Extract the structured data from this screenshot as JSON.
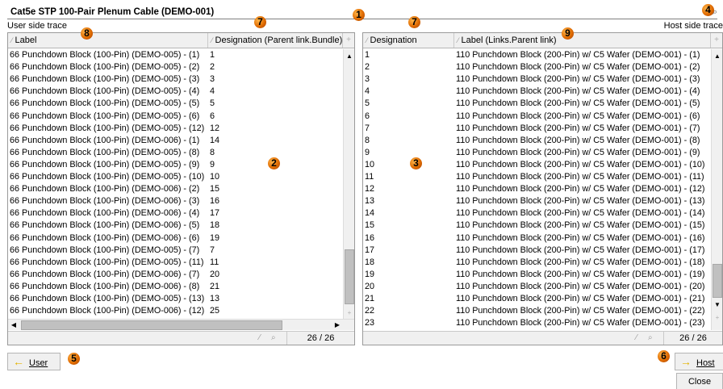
{
  "window": {
    "title": "Cat5e STP 100-Pair Plenum Cable (DEMO-001)"
  },
  "user_side": {
    "label": "User side trace"
  },
  "host_side": {
    "label": "Host side trace"
  },
  "left_table": {
    "columns": [
      "Label",
      "Designation (Parent link.Bundle)"
    ],
    "rows": [
      [
        "66 Punchdown Block (100-Pin) (DEMO-005) - (1)",
        "1"
      ],
      [
        "66 Punchdown Block (100-Pin) (DEMO-005) - (2)",
        "2"
      ],
      [
        "66 Punchdown Block (100-Pin) (DEMO-005) - (3)",
        "3"
      ],
      [
        "66 Punchdown Block (100-Pin) (DEMO-005) - (4)",
        "4"
      ],
      [
        "66 Punchdown Block (100-Pin) (DEMO-005) - (5)",
        "5"
      ],
      [
        "66 Punchdown Block (100-Pin) (DEMO-005) - (6)",
        "6"
      ],
      [
        "66 Punchdown Block (100-Pin) (DEMO-005) - (12)",
        "12"
      ],
      [
        "66 Punchdown Block (100-Pin) (DEMO-006) - (1)",
        "14"
      ],
      [
        "66 Punchdown Block (100-Pin) (DEMO-005) - (8)",
        "8"
      ],
      [
        "66 Punchdown Block (100-Pin) (DEMO-005) - (9)",
        "9"
      ],
      [
        "66 Punchdown Block (100-Pin) (DEMO-005) - (10)",
        "10"
      ],
      [
        "66 Punchdown Block (100-Pin) (DEMO-006) - (2)",
        "15"
      ],
      [
        "66 Punchdown Block (100-Pin) (DEMO-006) - (3)",
        "16"
      ],
      [
        "66 Punchdown Block (100-Pin) (DEMO-006) - (4)",
        "17"
      ],
      [
        "66 Punchdown Block (100-Pin) (DEMO-006) - (5)",
        "18"
      ],
      [
        "66 Punchdown Block (100-Pin) (DEMO-006) - (6)",
        "19"
      ],
      [
        "66 Punchdown Block (100-Pin) (DEMO-005) - (7)",
        "7"
      ],
      [
        "66 Punchdown Block (100-Pin) (DEMO-005) - (11)",
        "11"
      ],
      [
        "66 Punchdown Block (100-Pin) (DEMO-006) - (7)",
        "20"
      ],
      [
        "66 Punchdown Block (100-Pin) (DEMO-006) - (8)",
        "21"
      ],
      [
        "66 Punchdown Block (100-Pin) (DEMO-005) - (13)",
        "13"
      ],
      [
        "66 Punchdown Block (100-Pin) (DEMO-006) - (12)",
        "25"
      ]
    ],
    "counter": "26 / 26"
  },
  "right_table": {
    "columns": [
      "Designation",
      "Label (Links.Parent link)"
    ],
    "rows": [
      [
        "1",
        "110 Punchdown Block (200-Pin) w/ C5 Wafer (DEMO-001) - (1)"
      ],
      [
        "2",
        "110 Punchdown Block (200-Pin) w/ C5 Wafer (DEMO-001) - (2)"
      ],
      [
        "3",
        "110 Punchdown Block (200-Pin) w/ C5 Wafer (DEMO-001) - (3)"
      ],
      [
        "4",
        "110 Punchdown Block (200-Pin) w/ C5 Wafer (DEMO-001) - (4)"
      ],
      [
        "5",
        "110 Punchdown Block (200-Pin) w/ C5 Wafer (DEMO-001) - (5)"
      ],
      [
        "6",
        "110 Punchdown Block (200-Pin) w/ C5 Wafer (DEMO-001) - (6)"
      ],
      [
        "7",
        "110 Punchdown Block (200-Pin) w/ C5 Wafer (DEMO-001) - (7)"
      ],
      [
        "8",
        "110 Punchdown Block (200-Pin) w/ C5 Wafer (DEMO-001) - (8)"
      ],
      [
        "9",
        "110 Punchdown Block (200-Pin) w/ C5 Wafer (DEMO-001) - (9)"
      ],
      [
        "10",
        "110 Punchdown Block (200-Pin) w/ C5 Wafer (DEMO-001) - (10)"
      ],
      [
        "11",
        "110 Punchdown Block (200-Pin) w/ C5 Wafer (DEMO-001) - (11)"
      ],
      [
        "12",
        "110 Punchdown Block (200-Pin) w/ C5 Wafer (DEMO-001) - (12)"
      ],
      [
        "13",
        "110 Punchdown Block (200-Pin) w/ C5 Wafer (DEMO-001) - (13)"
      ],
      [
        "14",
        "110 Punchdown Block (200-Pin) w/ C5 Wafer (DEMO-001) - (14)"
      ],
      [
        "15",
        "110 Punchdown Block (200-Pin) w/ C5 Wafer (DEMO-001) - (15)"
      ],
      [
        "16",
        "110 Punchdown Block (200-Pin) w/ C5 Wafer (DEMO-001) - (16)"
      ],
      [
        "17",
        "110 Punchdown Block (200-Pin) w/ C5 Wafer (DEMO-001) - (17)"
      ],
      [
        "18",
        "110 Punchdown Block (200-Pin) w/ C5 Wafer (DEMO-001) - (18)"
      ],
      [
        "19",
        "110 Punchdown Block (200-Pin) w/ C5 Wafer (DEMO-001) - (19)"
      ],
      [
        "20",
        "110 Punchdown Block (200-Pin) w/ C5 Wafer (DEMO-001) - (20)"
      ],
      [
        "21",
        "110 Punchdown Block (200-Pin) w/ C5 Wafer (DEMO-001) - (21)"
      ],
      [
        "22",
        "110 Punchdown Block (200-Pin) w/ C5 Wafer (DEMO-001) - (22)"
      ],
      [
        "23",
        "110 Punchdown Block (200-Pin) w/ C5 Wafer (DEMO-001) - (23)"
      ]
    ],
    "counter": "26 / 26"
  },
  "buttons": {
    "user": "User",
    "host": "Host",
    "close": "Close"
  },
  "callouts": {
    "title": "1",
    "left_list": "2",
    "right_list": "3",
    "search": "4",
    "user_button": "5",
    "host_button": "6",
    "left_designation_header": "7",
    "right_designation_header": "7",
    "left_label_header": "8",
    "right_label_header": "9"
  },
  "icons": {
    "sort": "sort-indicator-icon",
    "add_column": "add-column-icon",
    "arrow": "arrow-icon",
    "search": "magnifier-icon",
    "filter": "filter-icon"
  },
  "colors": {
    "callout": "#e06b00",
    "arrow": "#e3b300",
    "scroll_thumb": "#c0c0c0"
  }
}
